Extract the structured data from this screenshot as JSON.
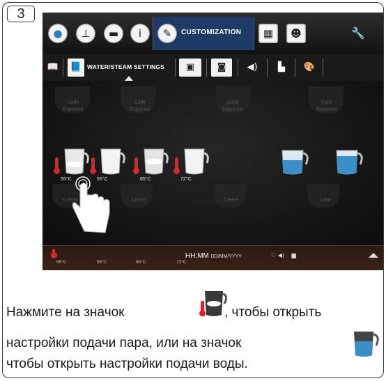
{
  "step_number": "3",
  "screen": {
    "top_bar": {
      "icons": [
        "water-drop-icon",
        "power-icon",
        "profile-card-icon",
        "info-icon"
      ],
      "active_item": {
        "icon": "pencil-icon",
        "label": "CUSTOMIZATION"
      },
      "right_icons": [
        "calculator-icon",
        "user-settings-icon"
      ],
      "settings_icon": "wrench-icon"
    },
    "tab_bar": {
      "tabs": [
        "book-icon",
        "book-water-icon"
      ],
      "active_tab_label": "WATER/STEAM SETTINGS",
      "other_tabs": [
        "picture-icon",
        "cup-icon",
        "speaker-icon",
        "brew-chart-icon",
        "palette-icon"
      ]
    },
    "background_labels": [
      "Caffè",
      "Espresso",
      "Caffè",
      "Espresso",
      "Caffè",
      "Espresso",
      "Caffè",
      "Espresso",
      "Crème",
      "Crème",
      "Crème",
      "Latte"
    ],
    "steam_items": [
      {
        "temp": "55°C",
        "selected": true
      },
      {
        "temp": "55°C",
        "selected": false
      },
      {
        "temp": "65°C",
        "selected": false
      },
      {
        "temp": "72°C",
        "selected": false
      }
    ],
    "water_items": [
      "water-jug-icon",
      "water-jug-icon"
    ],
    "bottom_bar": {
      "time": "HH:MM",
      "date": "DD/MM/YYYY",
      "temps": [
        "55°C",
        "55°C",
        "65°C",
        "72°C"
      ]
    }
  },
  "instruction": {
    "part1": "Нажмите на значок",
    "part2": ", чтобы открыть",
    "part3": "настройки подачи пара, или на значок",
    "part4": "чтобы открыть настройки подачи воды."
  },
  "colors": {
    "active_tab": "#1e3a66",
    "thermometer": "#d8262a",
    "water": "#3a8fc8"
  }
}
